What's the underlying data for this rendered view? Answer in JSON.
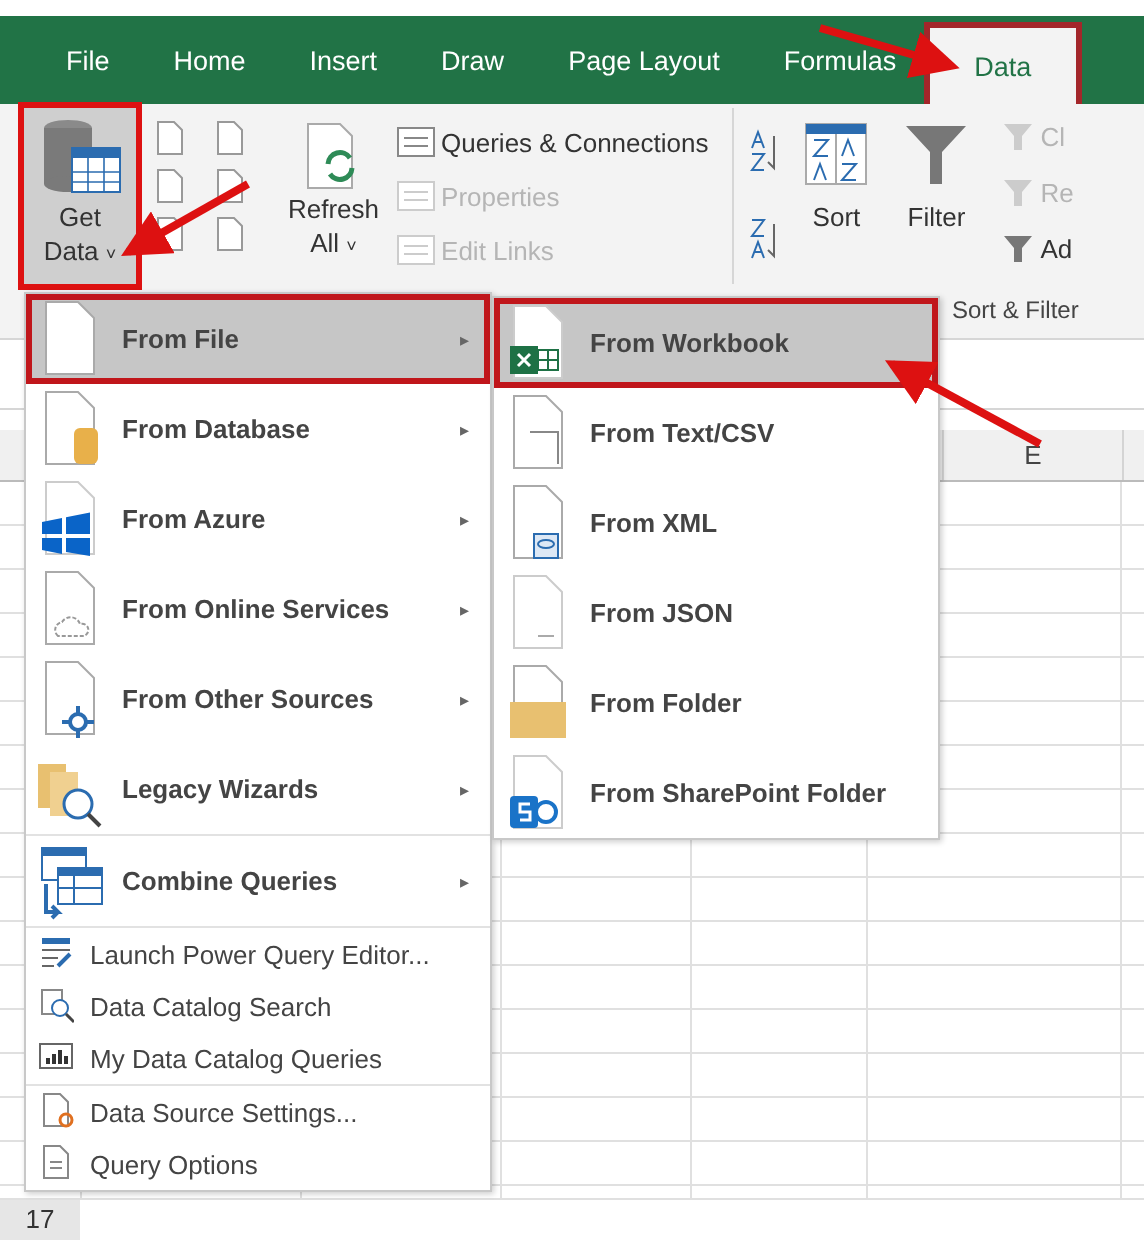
{
  "ribbon_tabs": [
    {
      "label": "File",
      "selected": false,
      "highlighted": false
    },
    {
      "label": "Home",
      "selected": false,
      "highlighted": false
    },
    {
      "label": "Insert",
      "selected": false,
      "highlighted": false
    },
    {
      "label": "Draw",
      "selected": false,
      "highlighted": false
    },
    {
      "label": "Page Layout",
      "selected": false,
      "highlighted": false
    },
    {
      "label": "Formulas",
      "selected": false,
      "highlighted": false
    },
    {
      "label": "Data",
      "selected": true,
      "highlighted": true
    }
  ],
  "ribbon": {
    "get_data": {
      "line_1": "Get",
      "line_2": "Data",
      "caret": "˅",
      "highlighted": true
    },
    "refresh_all": {
      "line_1": "Refresh",
      "line_2": "All",
      "caret": "˅"
    },
    "commands": [
      {
        "label": "Queries & Connections",
        "disabled": false
      },
      {
        "label": "Properties",
        "disabled": true
      },
      {
        "label": "Edit Links",
        "disabled": true
      }
    ],
    "sort": "Sort",
    "filter": "Filter",
    "cut_commands": [
      {
        "label": "Cl",
        "disabled": true
      },
      {
        "label": "Re",
        "disabled": true
      },
      {
        "label": "Ad",
        "disabled": false
      }
    ],
    "group_label": "Sort & Filter"
  },
  "sheet": {
    "column_header": "E",
    "row_header": "17"
  },
  "menu": {
    "items": [
      {
        "label": "From File",
        "kind": "large",
        "submenu": true,
        "selected": true,
        "highlighted": true,
        "separator_before": false
      },
      {
        "label": "From Database",
        "kind": "large",
        "submenu": true,
        "selected": false,
        "highlighted": false,
        "separator_before": false
      },
      {
        "label": "From Azure",
        "kind": "large",
        "submenu": true,
        "selected": false,
        "highlighted": false,
        "separator_before": false
      },
      {
        "label": "From Online Services",
        "kind": "large",
        "submenu": true,
        "selected": false,
        "highlighted": false,
        "separator_before": false
      },
      {
        "label": "From Other Sources",
        "kind": "large",
        "submenu": true,
        "selected": false,
        "highlighted": false,
        "separator_before": false
      },
      {
        "label": "Legacy Wizards",
        "kind": "large",
        "submenu": true,
        "selected": false,
        "highlighted": false,
        "separator_before": false
      },
      {
        "label": "Combine Queries",
        "kind": "large",
        "submenu": true,
        "selected": false,
        "highlighted": false,
        "separator_before": true
      },
      {
        "label": "Launch Power Query Editor...",
        "kind": "small",
        "submenu": false,
        "selected": false,
        "highlighted": false,
        "separator_before": true
      },
      {
        "label": "Data Catalog Search",
        "kind": "small",
        "submenu": false,
        "selected": false,
        "highlighted": false,
        "separator_before": false
      },
      {
        "label": "My Data Catalog Queries",
        "kind": "small",
        "submenu": false,
        "selected": false,
        "highlighted": false,
        "separator_before": false
      },
      {
        "label": "Data Source Settings...",
        "kind": "small",
        "submenu": false,
        "selected": false,
        "highlighted": false,
        "separator_before": true
      },
      {
        "label": "Query Options",
        "kind": "small",
        "submenu": false,
        "selected": false,
        "highlighted": false,
        "separator_before": false
      }
    ],
    "submenu_arrow": "▸"
  },
  "submenu": {
    "items": [
      {
        "label": "From Workbook",
        "selected": true,
        "highlighted": true
      },
      {
        "label": "From Text/CSV",
        "selected": false,
        "highlighted": false
      },
      {
        "label": "From XML",
        "selected": false,
        "highlighted": false
      },
      {
        "label": "From JSON",
        "selected": false,
        "highlighted": false
      },
      {
        "label": "From Folder",
        "selected": false,
        "highlighted": false
      },
      {
        "label": "From SharePoint Folder",
        "selected": false,
        "highlighted": false
      }
    ]
  }
}
